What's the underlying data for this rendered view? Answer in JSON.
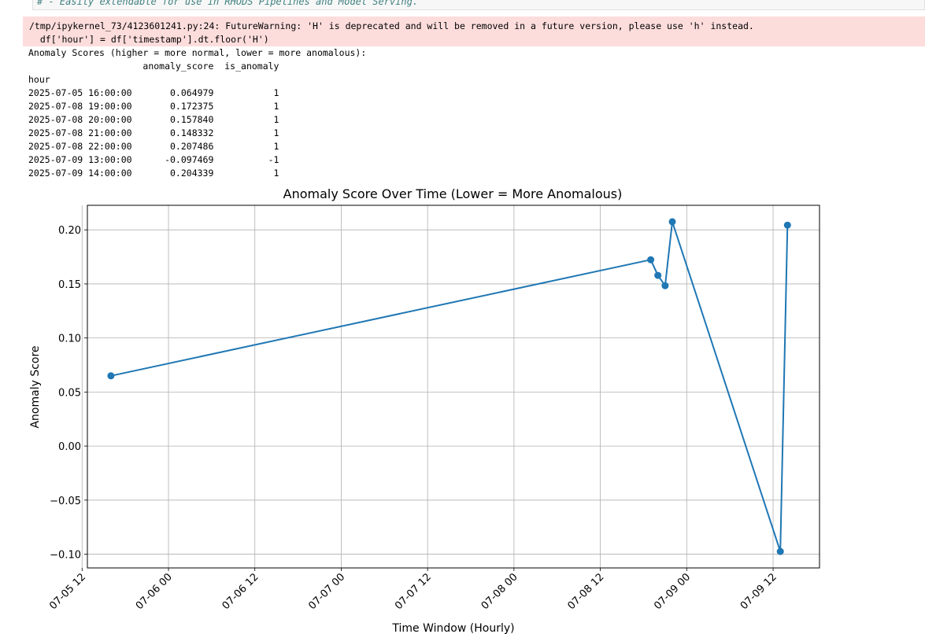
{
  "notebook": {
    "previous_cell_comment": "# - Easily extendable for use in RHODS Pipelines and Model Serving."
  },
  "stderr": {
    "lines": [
      "/tmp/ipykernel_73/4123601241.py:24: FutureWarning: 'H' is deprecated and will be removed in a future version, please use 'h' instead.",
      "  df['hour'] = df['timestamp'].dt.floor('H')"
    ]
  },
  "stdout": {
    "heading": "Anomaly Scores (higher = more normal, lower = more anomalous):",
    "table": {
      "columns_line": "                     anomaly_score  is_anomaly",
      "index_name": "hour",
      "rows": [
        "2025-07-05 16:00:00       0.064979           1",
        "2025-07-08 19:00:00       0.172375           1",
        "2025-07-08 20:00:00       0.157840           1",
        "2025-07-08 21:00:00       0.148332           1",
        "2025-07-08 22:00:00       0.207486           1",
        "2025-07-09 13:00:00      -0.097469          -1",
        "2025-07-09 14:00:00       0.204339           1"
      ]
    }
  },
  "chart_data": {
    "type": "line",
    "title": "Anomaly Score Over Time (Lower = More Anomalous)",
    "xlabel": "Time Window (Hourly)",
    "ylabel": "Anomaly Score",
    "x": [
      "2025-07-05 16:00",
      "2025-07-08 19:00",
      "2025-07-08 20:00",
      "2025-07-08 21:00",
      "2025-07-08 22:00",
      "2025-07-09 13:00",
      "2025-07-09 14:00"
    ],
    "values": [
      0.064979,
      0.172375,
      0.15784,
      0.148332,
      0.207486,
      -0.097469,
      0.204339
    ],
    "x_tick_values": [
      "2025-07-05 12:00",
      "2025-07-06 00:00",
      "2025-07-06 12:00",
      "2025-07-07 00:00",
      "2025-07-07 12:00",
      "2025-07-08 00:00",
      "2025-07-08 12:00",
      "2025-07-09 00:00",
      "2025-07-09 12:00"
    ],
    "x_tick_labels": [
      "07-05 12",
      "07-06 00",
      "07-06 12",
      "07-07 00",
      "07-07 12",
      "07-08 00",
      "07-08 12",
      "07-09 00",
      "07-09 12"
    ],
    "xlim": [
      "2025-07-05 12:44",
      "2025-07-09 18:27"
    ],
    "y_ticks": [
      0.2,
      0.15,
      0.1,
      0.05,
      0.0,
      -0.05,
      -0.1
    ],
    "y_tick_labels": [
      "0.20",
      "0.15",
      "0.10",
      "0.05",
      "0.00",
      "−0.05",
      "−0.10"
    ],
    "ylim": [
      -0.1127,
      0.2227
    ],
    "grid": true,
    "marker": "circle",
    "line_color": "#1f77b4"
  }
}
